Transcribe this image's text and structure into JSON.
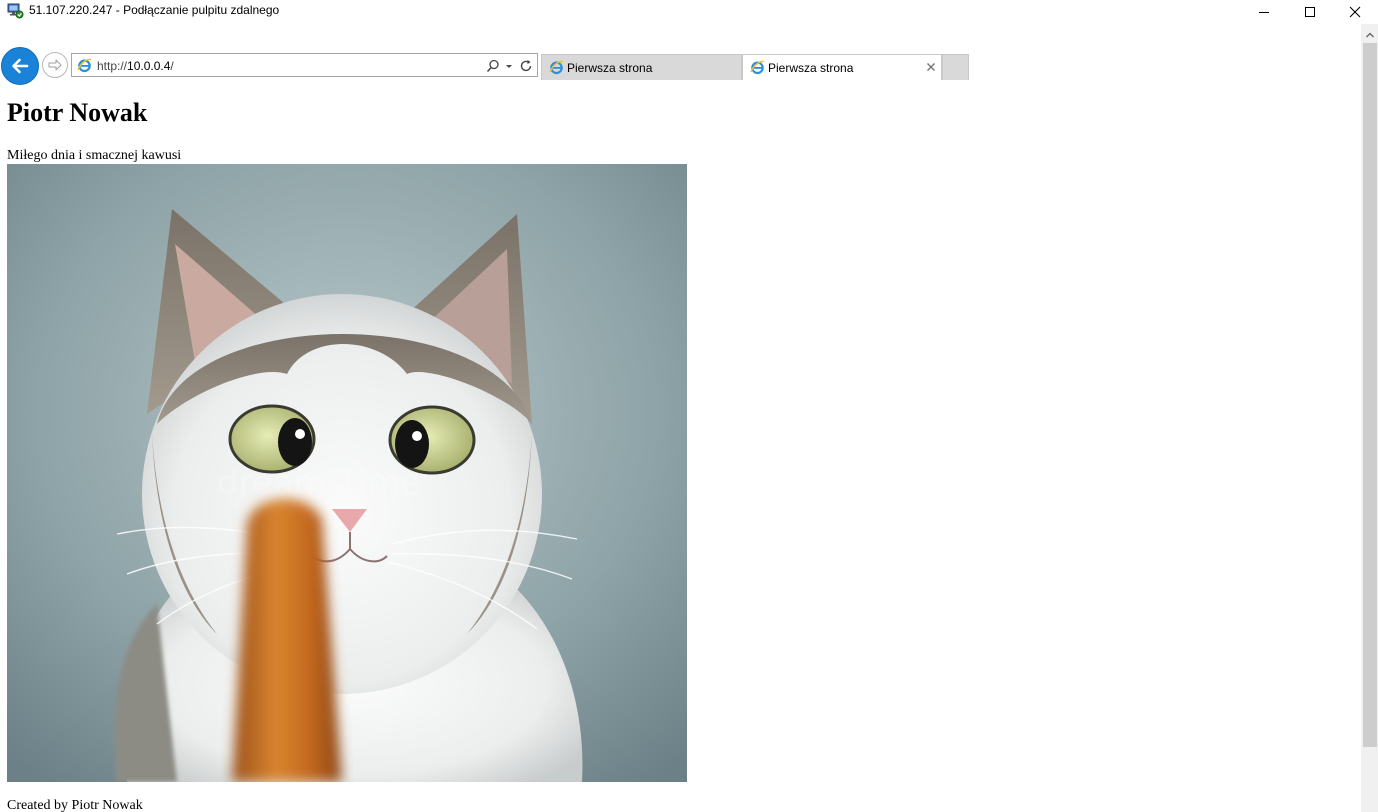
{
  "window": {
    "title": "51.107.220.247 - Podłączanie pulpitu zdalnego",
    "icon": "remote-desktop-icon",
    "controls": [
      "minimize-icon",
      "maximize-icon",
      "close-icon"
    ]
  },
  "browser": {
    "address": {
      "scheme": "http://",
      "host": "10.0.0.4",
      "path": "/"
    },
    "tabs": [
      {
        "label": "Pierwsza strona",
        "active": false
      },
      {
        "label": "Pierwsza strona",
        "active": true
      }
    ],
    "colors": {
      "back_button": "#1a82d7",
      "inactive_tab": "#d9d9d9"
    }
  },
  "page": {
    "heading": "Piotr Nowak",
    "subtext": "Miłego dnia i smacznej kawusi",
    "image": {
      "subject": "cross-eyed cat looking at a sausage",
      "watermark": "dreamstime"
    },
    "footer": "Created by Piotr Nowak"
  }
}
